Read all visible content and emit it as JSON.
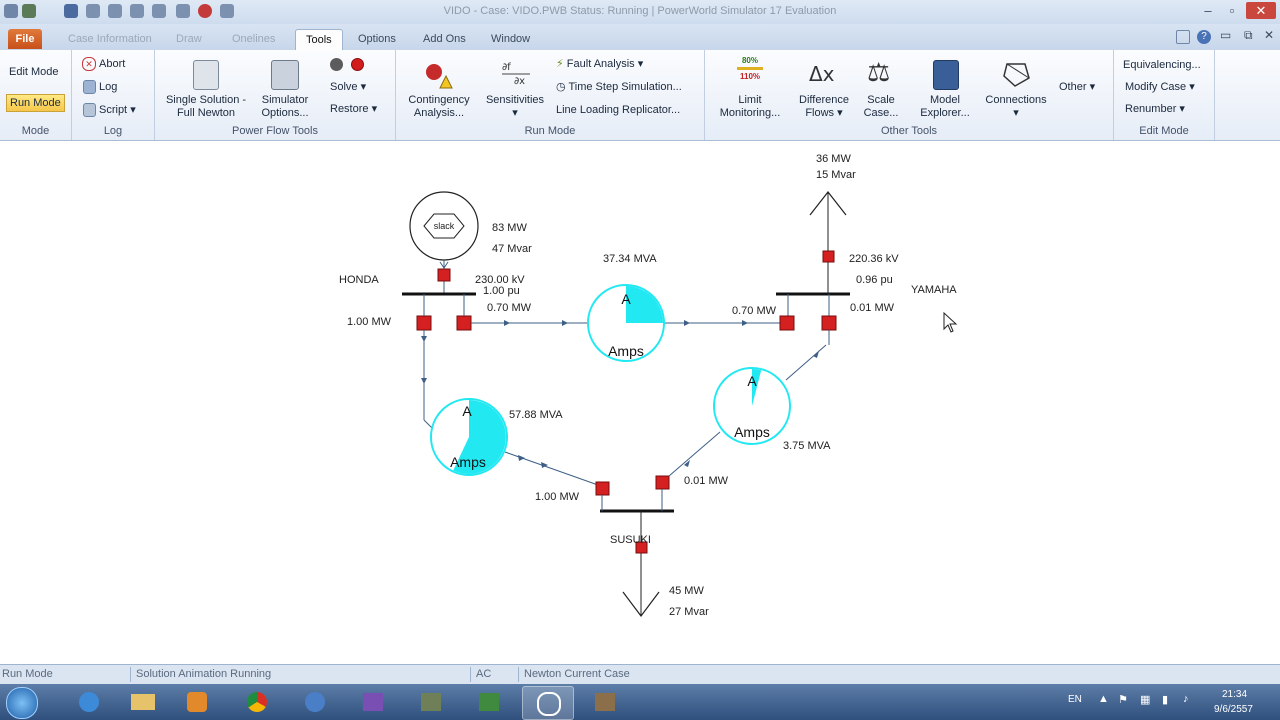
{
  "window": {
    "title": "VIDO - Case: VIDO.PWB  Status: Running | PowerWorld Simulator 17 Evaluation"
  },
  "tabs": [
    {
      "label": "File"
    },
    {
      "label": "Case Information"
    },
    {
      "label": "Draw"
    },
    {
      "label": "Onelines"
    },
    {
      "label": "Tools"
    },
    {
      "label": "Options"
    },
    {
      "label": "Add Ons"
    },
    {
      "label": "Window"
    }
  ],
  "ribbon": {
    "mode": {
      "edit": "Edit Mode",
      "run": "Run Mode",
      "label": "Mode"
    },
    "log": {
      "abort": "Abort",
      "log": "Log",
      "script": "Script",
      "label": "Log"
    },
    "power_flow": {
      "single_solution": "Single Solution - Full Newton",
      "simulator_options": "Simulator Options...",
      "solve": "Solve",
      "restore": "Restore",
      "label": "Power Flow Tools"
    },
    "run_mode": {
      "contingency": "Contingency Analysis...",
      "sensitivities": "Sensitivities",
      "fault_analysis": "Fault Analysis",
      "time_step": "Time Step Simulation...",
      "line_loading": "Line Loading Replicator...",
      "label": "Run Mode"
    },
    "other_tools": {
      "limit_monitoring": "Limit Monitoring...",
      "difference_flows": "Difference Flows",
      "scale_case": "Scale Case...",
      "model_explorer": "Model Explorer...",
      "connections": "Connections",
      "other": "Other",
      "label": "Other Tools",
      "limit_top": "80%",
      "limit_bottom": "110%"
    },
    "edit_mode": {
      "equivalencing": "Equivalencing...",
      "modify_case": "Modify Case",
      "renumber": "Renumber",
      "label": "Edit Mode"
    }
  },
  "icons": {
    "dropdown": "▾",
    "delta": "Δx",
    "scale": "⚖"
  },
  "diagram": {
    "slack": {
      "label": "slack",
      "mw": "83 MW",
      "mvar": "47 Mvar"
    },
    "honda": {
      "name": "HONDA",
      "kv": "230.00 kV",
      "pu": "1.00 pu",
      "mw_left": "1.00 MW",
      "mw_right": "0.70 MW"
    },
    "yamaha": {
      "name": "YAMAHA",
      "kv": "220.36 kV",
      "pu": "0.96 pu",
      "mw_left": "0.70 MW",
      "mw_right": "0.01 MW",
      "load_mw": "36 MW",
      "load_mvar": "15 Mvar"
    },
    "susuki": {
      "name": "SUSUKI",
      "mw_left": "1.00 MW",
      "mw_right": "0.01 MW",
      "load_mw": "45 MW",
      "load_mvar": "27 Mvar"
    },
    "line_top": {
      "mva": "37.34 MVA",
      "letter": "A",
      "unit": "Amps",
      "loading": 0.25
    },
    "line_left": {
      "mva": "57.88 MVA",
      "letter": "A",
      "unit": "Amps",
      "loading": 0.57
    },
    "line_right": {
      "mva": "3.75 MVA",
      "letter": "A",
      "unit": "Amps",
      "loading": 0.04
    },
    "colors": {
      "pie": "#22e8f2",
      "breaker": "#d42020",
      "bus": "#111111",
      "line": "#3e5f86"
    }
  },
  "status": {
    "mode": "Run Mode",
    "animation": "Solution Animation Running",
    "ac": "AC",
    "newton": "Newton Current Case"
  },
  "tray": {
    "lang": "EN",
    "time": "21:34",
    "date": "9/6/2557"
  }
}
